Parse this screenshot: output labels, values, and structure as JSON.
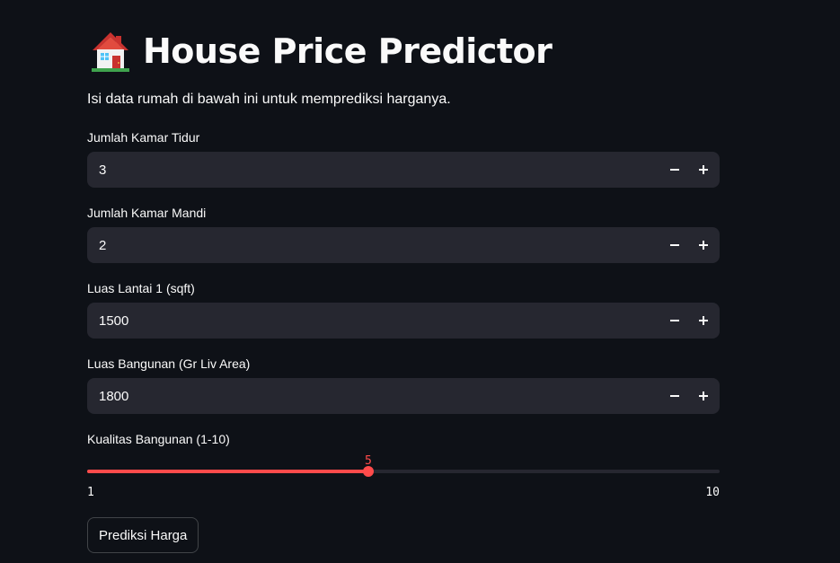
{
  "header": {
    "icon": "house-emoji-icon",
    "title": "House Price Predictor"
  },
  "subtitle": "Isi data rumah di bawah ini untuk memprediksi harganya.",
  "inputs": [
    {
      "label": "Jumlah Kamar Tidur",
      "value": "3"
    },
    {
      "label": "Jumlah Kamar Mandi",
      "value": "2"
    },
    {
      "label": "Luas Lantai 1 (sqft)",
      "value": "1500"
    },
    {
      "label": "Luas Bangunan (Gr Liv Area)",
      "value": "1800"
    }
  ],
  "slider": {
    "label": "Kualitas Bangunan (1-10)",
    "value": 5,
    "min": 1,
    "max": 10,
    "value_text": "5",
    "min_text": "1",
    "max_text": "10"
  },
  "button": {
    "label": "Prediksi Harga"
  },
  "colors": {
    "background": "#0e1117",
    "input_background": "#262730",
    "accent": "#ff4b4b",
    "text": "#fafafa"
  }
}
